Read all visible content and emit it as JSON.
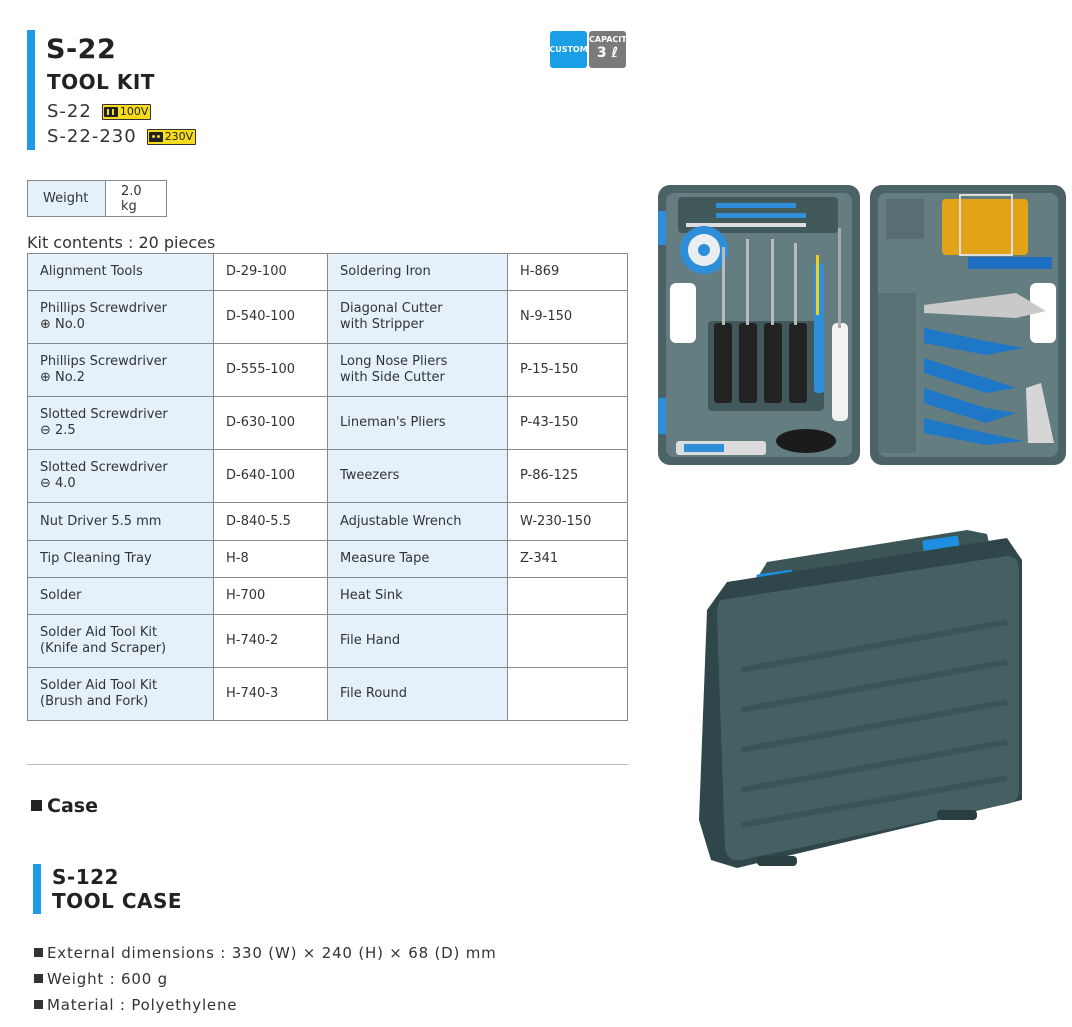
{
  "product": {
    "code": "S-22",
    "name": "TOOL KIT",
    "variants": [
      {
        "code": "S-22",
        "voltage": "100V"
      },
      {
        "code": "S-22-230",
        "voltage": "230V"
      }
    ],
    "badges": {
      "custom": "CUSTOM",
      "capacity_label": "CAPACITY",
      "capacity_value": "3 ℓ"
    }
  },
  "weight": {
    "label": "Weight",
    "value": "2.0 kg"
  },
  "kit_contents_label": "Kit contents : 20 pieces",
  "contents": [
    {
      "name1": "Alignment Tools",
      "code1": "D-29-100",
      "name2": "Soldering Iron",
      "code2": "H-869"
    },
    {
      "name1": "Phillips Screwdriver\n⊕ No.0",
      "code1": "D-540-100",
      "name2": "Diagonal Cutter\nwith Stripper",
      "code2": "N-9-150"
    },
    {
      "name1": "Phillips Screwdriver\n⊕ No.2",
      "code1": "D-555-100",
      "name2": "Long Nose Pliers\nwith Side Cutter",
      "code2": "P-15-150"
    },
    {
      "name1": "Slotted Screwdriver\n⊖ 2.5",
      "code1": "D-630-100",
      "name2": "Lineman's Pliers",
      "code2": "P-43-150"
    },
    {
      "name1": "Slotted Screwdriver\n⊖ 4.0",
      "code1": "D-640-100",
      "name2": "Tweezers",
      "code2": "P-86-125"
    },
    {
      "name1": "Nut Driver 5.5 mm",
      "code1": "D-840-5.5",
      "name2": "Adjustable Wrench",
      "code2": "W-230-150"
    },
    {
      "name1": "Tip Cleaning Tray",
      "code1": "H-8",
      "name2": "Measure Tape",
      "code2": "Z-341"
    },
    {
      "name1": "Solder",
      "code1": "H-700",
      "name2": "Heat Sink",
      "code2": ""
    },
    {
      "name1": "Solder Aid Tool Kit\n(Knife and Scraper)",
      "code1": "H-740-2",
      "name2": "File Hand",
      "code2": ""
    },
    {
      "name1": "Solder Aid Tool Kit\n(Brush and Fork)",
      "code1": "H-740-3",
      "name2": "File Round",
      "code2": ""
    }
  ],
  "case_section": {
    "heading": "Case",
    "code": "S-122",
    "name": "TOOL CASE",
    "specs": [
      "External dimensions : 330 (W) × 240 (H) × 68 (D) mm",
      "Weight : 600 g",
      "Material : Polyethylene"
    ]
  },
  "colors": {
    "accent": "#1e9be6",
    "label_cell": "#e4f0fa",
    "voltage_badge": "#f6dc1c",
    "case_green": "#3f5a5c"
  }
}
